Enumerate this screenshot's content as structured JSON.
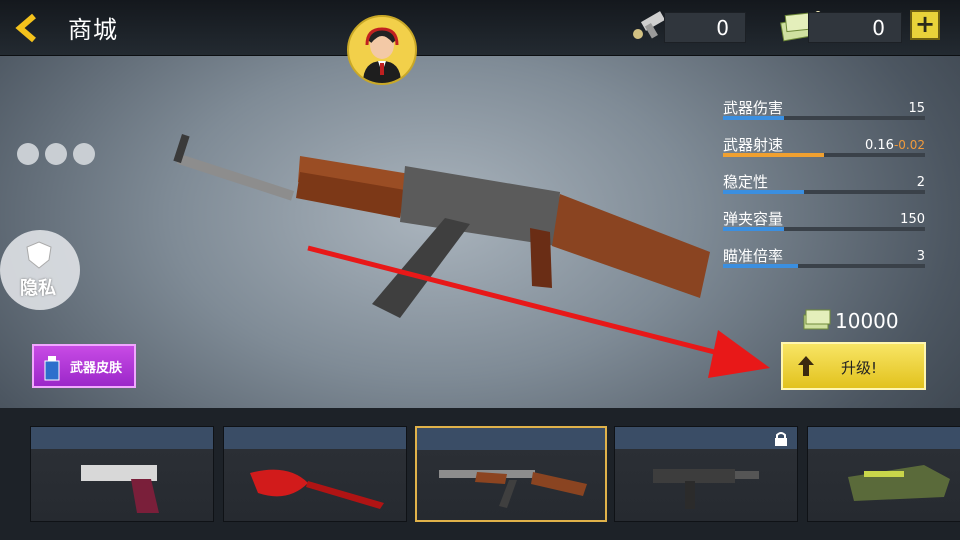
{
  "header": {
    "title": "商城",
    "currency_1": "0",
    "currency_2": "0",
    "add_label": "+"
  },
  "stats": [
    {
      "label": "武器伤害",
      "value": "15",
      "delta": "",
      "level": 0.3
    },
    {
      "label": "武器射速",
      "value": "0.16",
      "delta": "-0.02",
      "level": 0.5
    },
    {
      "label": "稳定性",
      "value": "2",
      "delta": "",
      "level": 0.4
    },
    {
      "label": "弹夹容量",
      "value": "150",
      "delta": "",
      "level": 0.3
    },
    {
      "label": "瞄准倍率",
      "value": "3",
      "delta": "",
      "level": 0.37
    }
  ],
  "stars": 3,
  "privacy_label": "隐私",
  "skin_button_label": "武器皮肤",
  "price": "10000",
  "upgrade_label": "升级!",
  "weapons": [
    {
      "name": "desert-eagle",
      "locked": false,
      "selected": false
    },
    {
      "name": "butterfly-knife",
      "locked": false,
      "selected": false
    },
    {
      "name": "ak47",
      "locked": false,
      "selected": true
    },
    {
      "name": "smg",
      "locked": true,
      "selected": false
    },
    {
      "name": "p90",
      "locked": false,
      "selected": false
    }
  ],
  "colors": {
    "accent": "#e8d23a",
    "stat_bar": "#3b8fe0",
    "stat_bar_alt": "#f0a030",
    "arrow": "#e81818"
  }
}
